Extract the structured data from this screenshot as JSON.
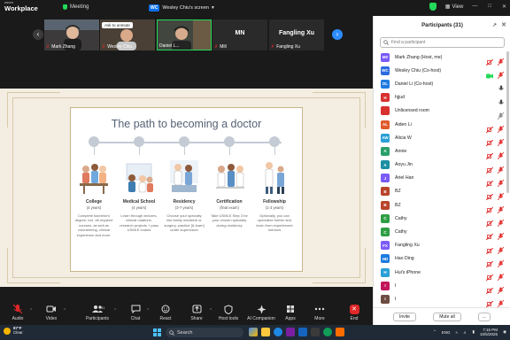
{
  "topbar": {
    "brand_top": "zoom",
    "brand_main": "Workplace",
    "meeting_label": "Meeting",
    "share_badge": "WC",
    "share_label": "Wesley Chiu's screen",
    "view_label": "View",
    "shield_color": "#23d959"
  },
  "strip": {
    "tiles": [
      {
        "name": "Mark Zhang",
        "muted": true
      },
      {
        "name": "Wesley Chiu",
        "muted": true,
        "overlay": "Ask to unmute"
      },
      {
        "name": "Daniel L...",
        "muted": false,
        "active": true
      },
      {
        "name": "Mill",
        "initials": "MN",
        "muted": true
      },
      {
        "name": "Fangling Xu",
        "bigname": "Fangling Xu",
        "muted": true
      }
    ]
  },
  "slide": {
    "title": "The path to becoming a doctor",
    "steps": [
      {
        "heading": "College",
        "duration": "(4 years)",
        "desc": "Complete bachelor's degree, incl. all required courses, as well as volunteering, clinical experience and more."
      },
      {
        "heading": "Medical School",
        "duration": "(4 years)",
        "desc": "Learn through lectures, clinical rotations, research projects + pass USMLE exams"
      },
      {
        "heading": "Residency",
        "duration": "(3-7 years)",
        "desc": "Choose your specialty like family medicine or surgery, practice [& learn] under supervision"
      },
      {
        "heading": "Certification",
        "duration": "(final exam)",
        "desc": "Take USMLE Step 3 for your chosen specialty during residency"
      },
      {
        "heading": "Fellowship",
        "duration": "(1-3 years)",
        "desc": "Optionally, you can specialize further and learn from experienced mentors"
      }
    ]
  },
  "toolbar": {
    "audio": "Audio",
    "video": "Video",
    "participants": "Participants",
    "participants_count": "31",
    "chat": "Chat",
    "react": "React",
    "share": "Share",
    "host_tools": "Host tools",
    "ai_companion": "AI Companion",
    "apps": "Apps",
    "more": "More",
    "end": "End",
    "end_color": "#e02828"
  },
  "panel": {
    "title": "Participants (31)",
    "search_placeholder": "Find a participant",
    "invite_label": "Invite",
    "mute_all_label": "Mute all",
    "more_label": "...",
    "participants": [
      {
        "initials": "MZ",
        "color": "#7a5af8",
        "name": "Mark Zhang (Host, me)",
        "video": false,
        "mic": "off-red"
      },
      {
        "initials": "WC",
        "color": "#2d6cdf",
        "name": "Wesley Chiu (Co-host)",
        "video": "on",
        "mic": "off-red"
      },
      {
        "initials": "DL",
        "color": "#1f7ae0",
        "name": "Daniel Li (Co-host)",
        "video": "none",
        "mic": "on"
      },
      {
        "initials": "H",
        "color": "#d8312f",
        "name": "hjjud",
        "video": "none",
        "mic": "on"
      },
      {
        "initials": "",
        "color": "#d8312f",
        "name": "Unlicensed room",
        "video": "none",
        "mic": "off-grey"
      },
      {
        "initials": "AL",
        "color": "#e05a2a",
        "name": "Aiden Li",
        "video": false,
        "mic": "off-red"
      },
      {
        "initials": "AW",
        "color": "#2a9fd6",
        "name": "Alicia W",
        "video": false,
        "mic": "off-red"
      },
      {
        "initials": "A",
        "color": "#2a9f6a",
        "name": "Annie",
        "video": false,
        "mic": "off-red"
      },
      {
        "initials": "A",
        "color": "#1c8fa3",
        "name": "Aoyu Jin",
        "video": false,
        "mic": "off-red"
      },
      {
        "initials": "J",
        "color": "#7a5af8",
        "name": "Ariel Han",
        "video": false,
        "mic": "off-red"
      },
      {
        "initials": "B",
        "color": "#b8442b",
        "name": "BZ",
        "video": false,
        "mic": "off-red"
      },
      {
        "initials": "B",
        "color": "#b8442b",
        "name": "BZ",
        "video": false,
        "mic": "off-red"
      },
      {
        "initials": "C",
        "color": "#2f9e44",
        "name": "Cathy",
        "video": false,
        "mic": "off-red"
      },
      {
        "initials": "C",
        "color": "#2f9e44",
        "name": "Cathy",
        "video": false,
        "mic": "off-red"
      },
      {
        "initials": "FX",
        "color": "#7a5af8",
        "name": "Fangling Xu",
        "video": false,
        "mic": "off-red"
      },
      {
        "initials": "HD",
        "color": "#1f7ae0",
        "name": "Hao Ding",
        "video": false,
        "mic": "off-red"
      },
      {
        "initials": "H",
        "color": "#2a9fd6",
        "name": "Hui's iPhone",
        "video": false,
        "mic": "off-red"
      },
      {
        "initials": "I",
        "color": "#c2185b",
        "name": "I",
        "video": false,
        "mic": "off-red"
      },
      {
        "initials": "I",
        "color": "#6d4c41",
        "name": "I",
        "video": false,
        "mic": "off-red"
      }
    ]
  },
  "taskbar": {
    "temp": "87°F",
    "weather": "Clear",
    "search_label": "Search",
    "lang": "ENG",
    "time": "7:15 PM",
    "date": "10/5/2025"
  }
}
